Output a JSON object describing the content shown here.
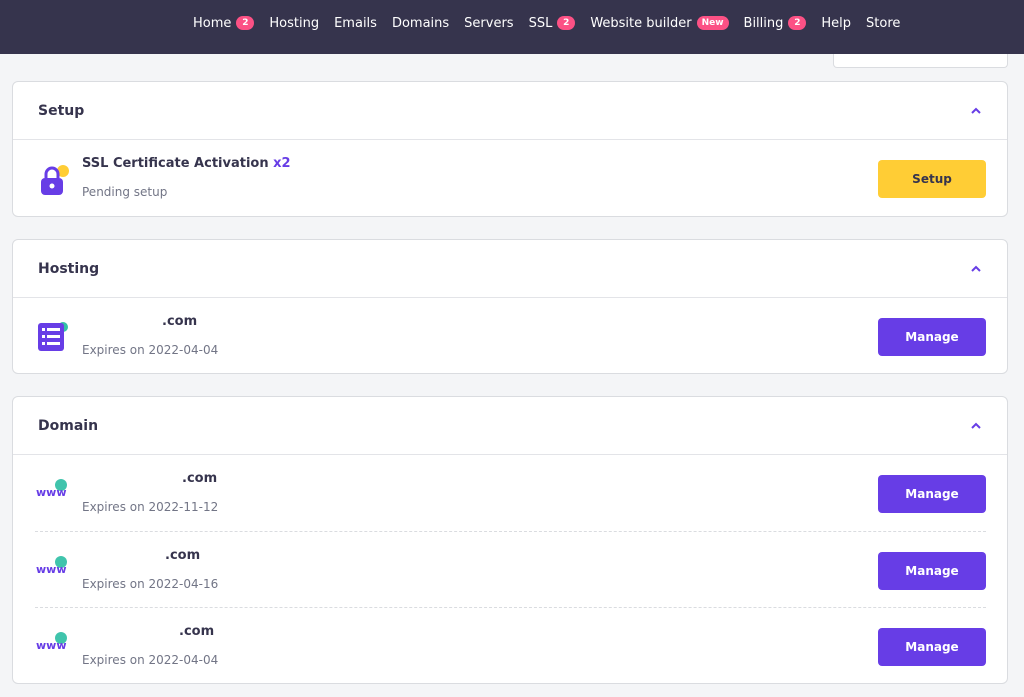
{
  "nav": {
    "items": [
      {
        "label": "Home",
        "badge": "2"
      },
      {
        "label": "Hosting"
      },
      {
        "label": "Emails"
      },
      {
        "label": "Domains"
      },
      {
        "label": "Servers"
      },
      {
        "label": "SSL",
        "badge": "2"
      },
      {
        "label": "Website builder",
        "badge": "New"
      },
      {
        "label": "Billing",
        "badge": "2"
      },
      {
        "label": "Help"
      },
      {
        "label": "Store"
      }
    ]
  },
  "setup": {
    "title": "Setup",
    "items": [
      {
        "name": "SSL Certificate Activation",
        "multiplier": "x2",
        "status": "Pending setup",
        "button": "Setup",
        "icon": "lock-icon"
      }
    ]
  },
  "hosting": {
    "title": "Hosting",
    "items": [
      {
        "name": ".com",
        "status": "Expires on 2022-04-04",
        "button": "Manage",
        "icon": "server-icon"
      }
    ]
  },
  "domain": {
    "title": "Domain",
    "items": [
      {
        "name": ".com",
        "status": "Expires on 2022-11-12",
        "button": "Manage",
        "icon": "www-icon"
      },
      {
        "name": ".com",
        "status": "Expires on 2022-04-16",
        "button": "Manage",
        "icon": "www-icon"
      },
      {
        "name": ".com",
        "status": "Expires on 2022-04-04",
        "button": "Manage",
        "icon": "www-icon"
      }
    ]
  },
  "colors": {
    "nav_bg": "#36344d",
    "accent": "#673de6",
    "badge": "#fc5185",
    "setup_button": "#ffcd35"
  }
}
